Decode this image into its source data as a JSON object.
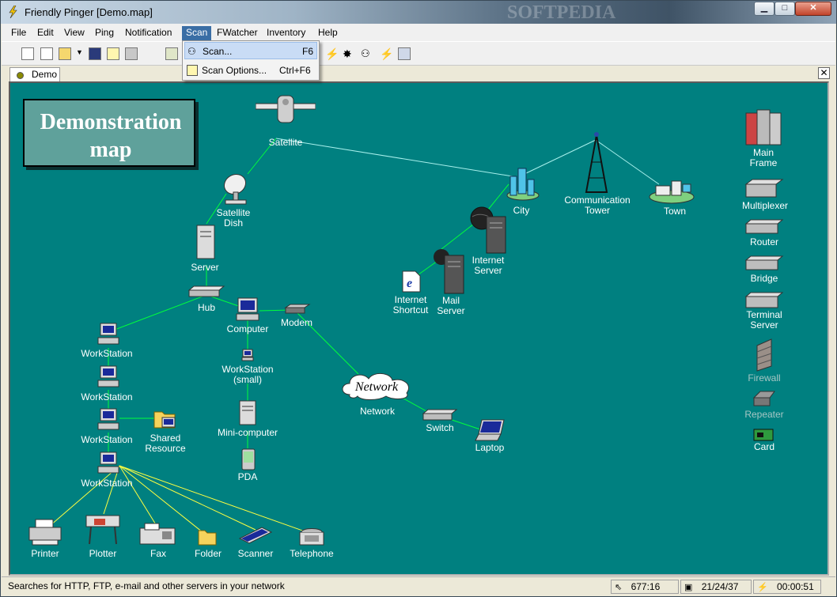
{
  "window": {
    "title": "Friendly Pinger [Demo.map]"
  },
  "menubar": [
    "File",
    "Edit",
    "View",
    "Ping",
    "Notification",
    "Scan",
    "FWatcher",
    "Inventory",
    "Help"
  ],
  "scan_menu": {
    "items": [
      {
        "label": "Scan...",
        "shortcut": "F6"
      },
      {
        "label": "Scan Options...",
        "shortcut": "Ctrl+F6"
      }
    ]
  },
  "tab": {
    "label": "Demo"
  },
  "map": {
    "title_box": "Demonstration map",
    "nodes": {
      "satellite": "Satellite",
      "satellite_dish": "Satellite\nDish",
      "server": "Server",
      "hub": "Hub",
      "computer": "Computer",
      "modem": "Modem",
      "ws1": "WorkStation",
      "ws2": "WorkStation",
      "ws3": "WorkStation",
      "ws4": "WorkStation",
      "ws_small": "WorkStation\n(small)",
      "shared": "Shared\nResource",
      "mini": "Mini-computer",
      "pda": "PDA",
      "network_cloud": "Network",
      "network": "Network",
      "switch": "Switch",
      "laptop": "Laptop",
      "printer": "Printer",
      "plotter": "Plotter",
      "fax": "Fax",
      "folder": "Folder",
      "scanner": "Scanner",
      "telephone": "Telephone",
      "city": "City",
      "tower": "Communication\nTower",
      "town": "Town",
      "internet_server": "Internet\nServer",
      "mail_server": "Mail\nServer",
      "internet_shortcut": "Internet\nShortcut",
      "mainframe": "Main\nFrame",
      "multiplexer": "Multiplexer",
      "router": "Router",
      "bridge": "Bridge",
      "terminal": "Terminal\nServer",
      "firewall": "Firewall",
      "repeater": "Repeater",
      "card": "Card"
    }
  },
  "status": {
    "message": "Searches for HTTP, FTP, e-mail and other servers in your network",
    "coords": "677:16",
    "counts": "21/24/37",
    "time": "00:00:51"
  },
  "watermark": "SOFTPEDIA",
  "colors": {
    "map_bg": "#008080",
    "link_green": "#00ff40",
    "link_cyan": "#a0f0f0"
  }
}
